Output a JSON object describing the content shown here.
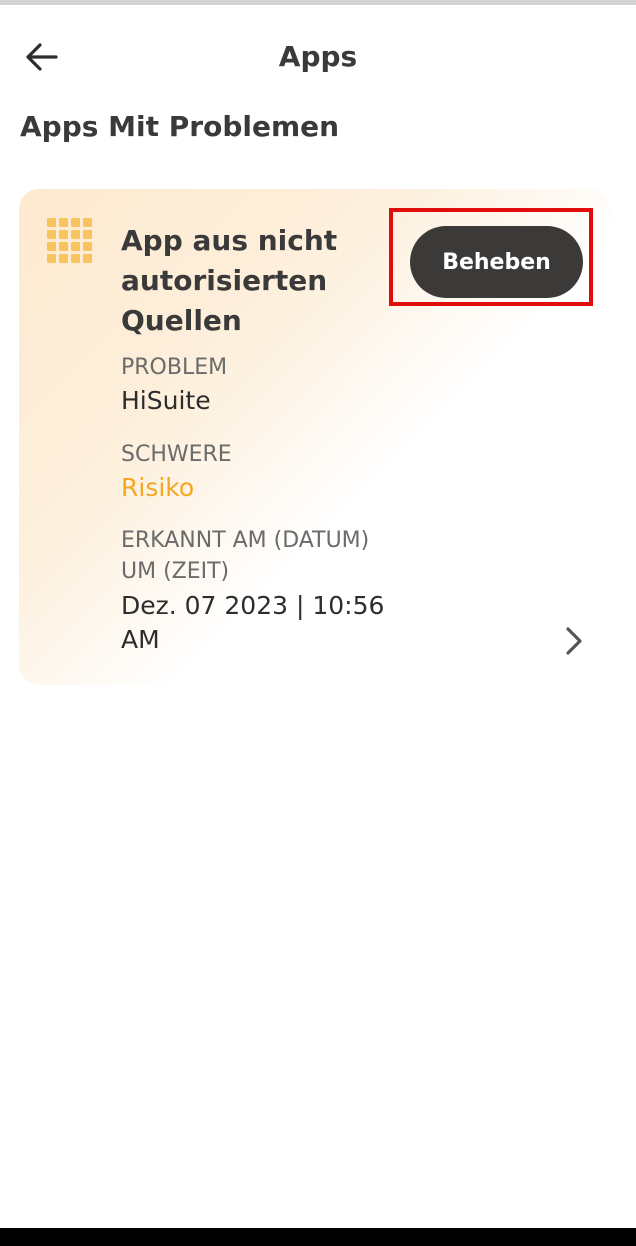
{
  "header": {
    "title": "Apps",
    "back_icon": "arrow-left-icon"
  },
  "section": {
    "title": "Apps Mit Problemen"
  },
  "issue": {
    "icon": "app-grid-icon",
    "title": "App aus nicht autorisierten Quellen",
    "fix_label": "Beheben",
    "problem_label": "PROBLEM",
    "problem_value": "HiSuite",
    "severity_label": "SCHWERE",
    "severity_value": "Risiko",
    "detected_label": "ERKANNT AM (DATUM) UM (ZEIT)",
    "detected_value": "Dez. 07 2023 | 10:56 AM",
    "chevron_icon": "chevron-right-icon"
  },
  "colors": {
    "accent": "#f5a623",
    "icon_yellow": "#f9c460",
    "button_dark": "#3c3a38",
    "highlight_red": "#e10d0d"
  }
}
